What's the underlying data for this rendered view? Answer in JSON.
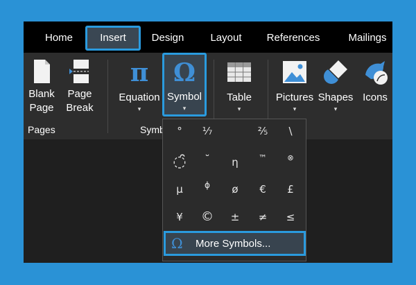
{
  "tabs": [
    {
      "label": "Home"
    },
    {
      "label": "Insert"
    },
    {
      "label": "Design"
    },
    {
      "label": "Layout"
    },
    {
      "label": "References"
    },
    {
      "label": "Mailings"
    }
  ],
  "ribbon": {
    "pages_group": {
      "label": "Pages",
      "blank_page": {
        "line1": "Blank",
        "line2": "Page"
      },
      "page_break": {
        "line1": "Page",
        "line2": "Break"
      }
    },
    "symbols_group": {
      "label": "Symb",
      "equation": {
        "label": "Equation",
        "caret": "▾"
      },
      "symbol": {
        "label": "Symbol",
        "caret": "▾"
      }
    },
    "table": {
      "label": "Table",
      "caret": "▾"
    },
    "pictures": {
      "label": "Pictures",
      "caret": "▾"
    },
    "shapes": {
      "label": "Shapes",
      "caret": "▾"
    },
    "icons": {
      "label": "Icons"
    }
  },
  "symbol_gallery": {
    "rows": [
      [
        "°",
        "⅐",
        "",
        "⅖",
        "\\"
      ],
      [
        "◌̑",
        "˘",
        "η",
        "™",
        "⊗"
      ],
      [
        "μ",
        "ϕ",
        "ø",
        "€",
        "£"
      ],
      [
        "¥",
        "©",
        "±",
        "≠",
        "≤"
      ]
    ],
    "more_symbols": {
      "icon": "Ω",
      "label": "More Symbols..."
    }
  },
  "colors": {
    "accent": "#2a9bdf",
    "icon_blue": "#3f8fd6"
  }
}
